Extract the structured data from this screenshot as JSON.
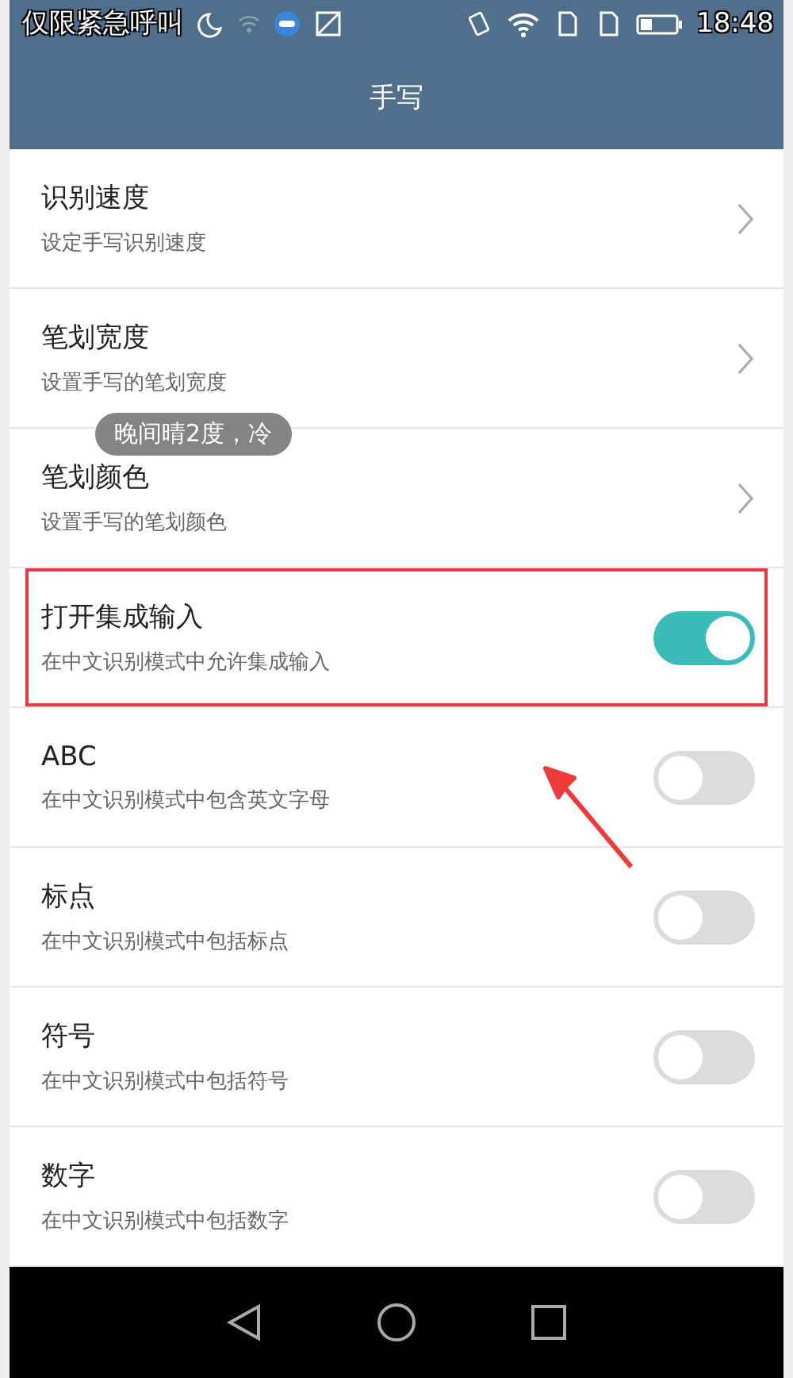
{
  "status_bar": {
    "carrier": "仅限紧急呼叫",
    "time": "18:48"
  },
  "title": "手写",
  "items": [
    {
      "kind": "link",
      "title": "识别速度",
      "subtitle": "设定手写识别速度",
      "highlighted": false
    },
    {
      "kind": "link",
      "title": "笔划宽度",
      "subtitle": "设置手写的笔划宽度",
      "highlighted": false
    },
    {
      "kind": "link",
      "title": "笔划颜色",
      "subtitle": "设置手写的笔划颜色",
      "highlighted": false
    },
    {
      "kind": "switch",
      "title": "打开集成输入",
      "subtitle": "在中文识别模式中允许集成输入",
      "on": true,
      "highlighted": true
    },
    {
      "kind": "switch",
      "title": "ABC",
      "subtitle": "在中文识别模式中包含英文字母",
      "on": false,
      "highlighted": false
    },
    {
      "kind": "switch",
      "title": "标点",
      "subtitle": "在中文识别模式中包括标点",
      "on": false,
      "highlighted": false
    },
    {
      "kind": "switch",
      "title": "符号",
      "subtitle": "在中文识别模式中包括符号",
      "on": false,
      "highlighted": false
    },
    {
      "kind": "switch",
      "title": "数字",
      "subtitle": "在中文识别模式中包括数字",
      "on": false,
      "highlighted": false
    }
  ],
  "toast": "晚间晴2度，冷"
}
